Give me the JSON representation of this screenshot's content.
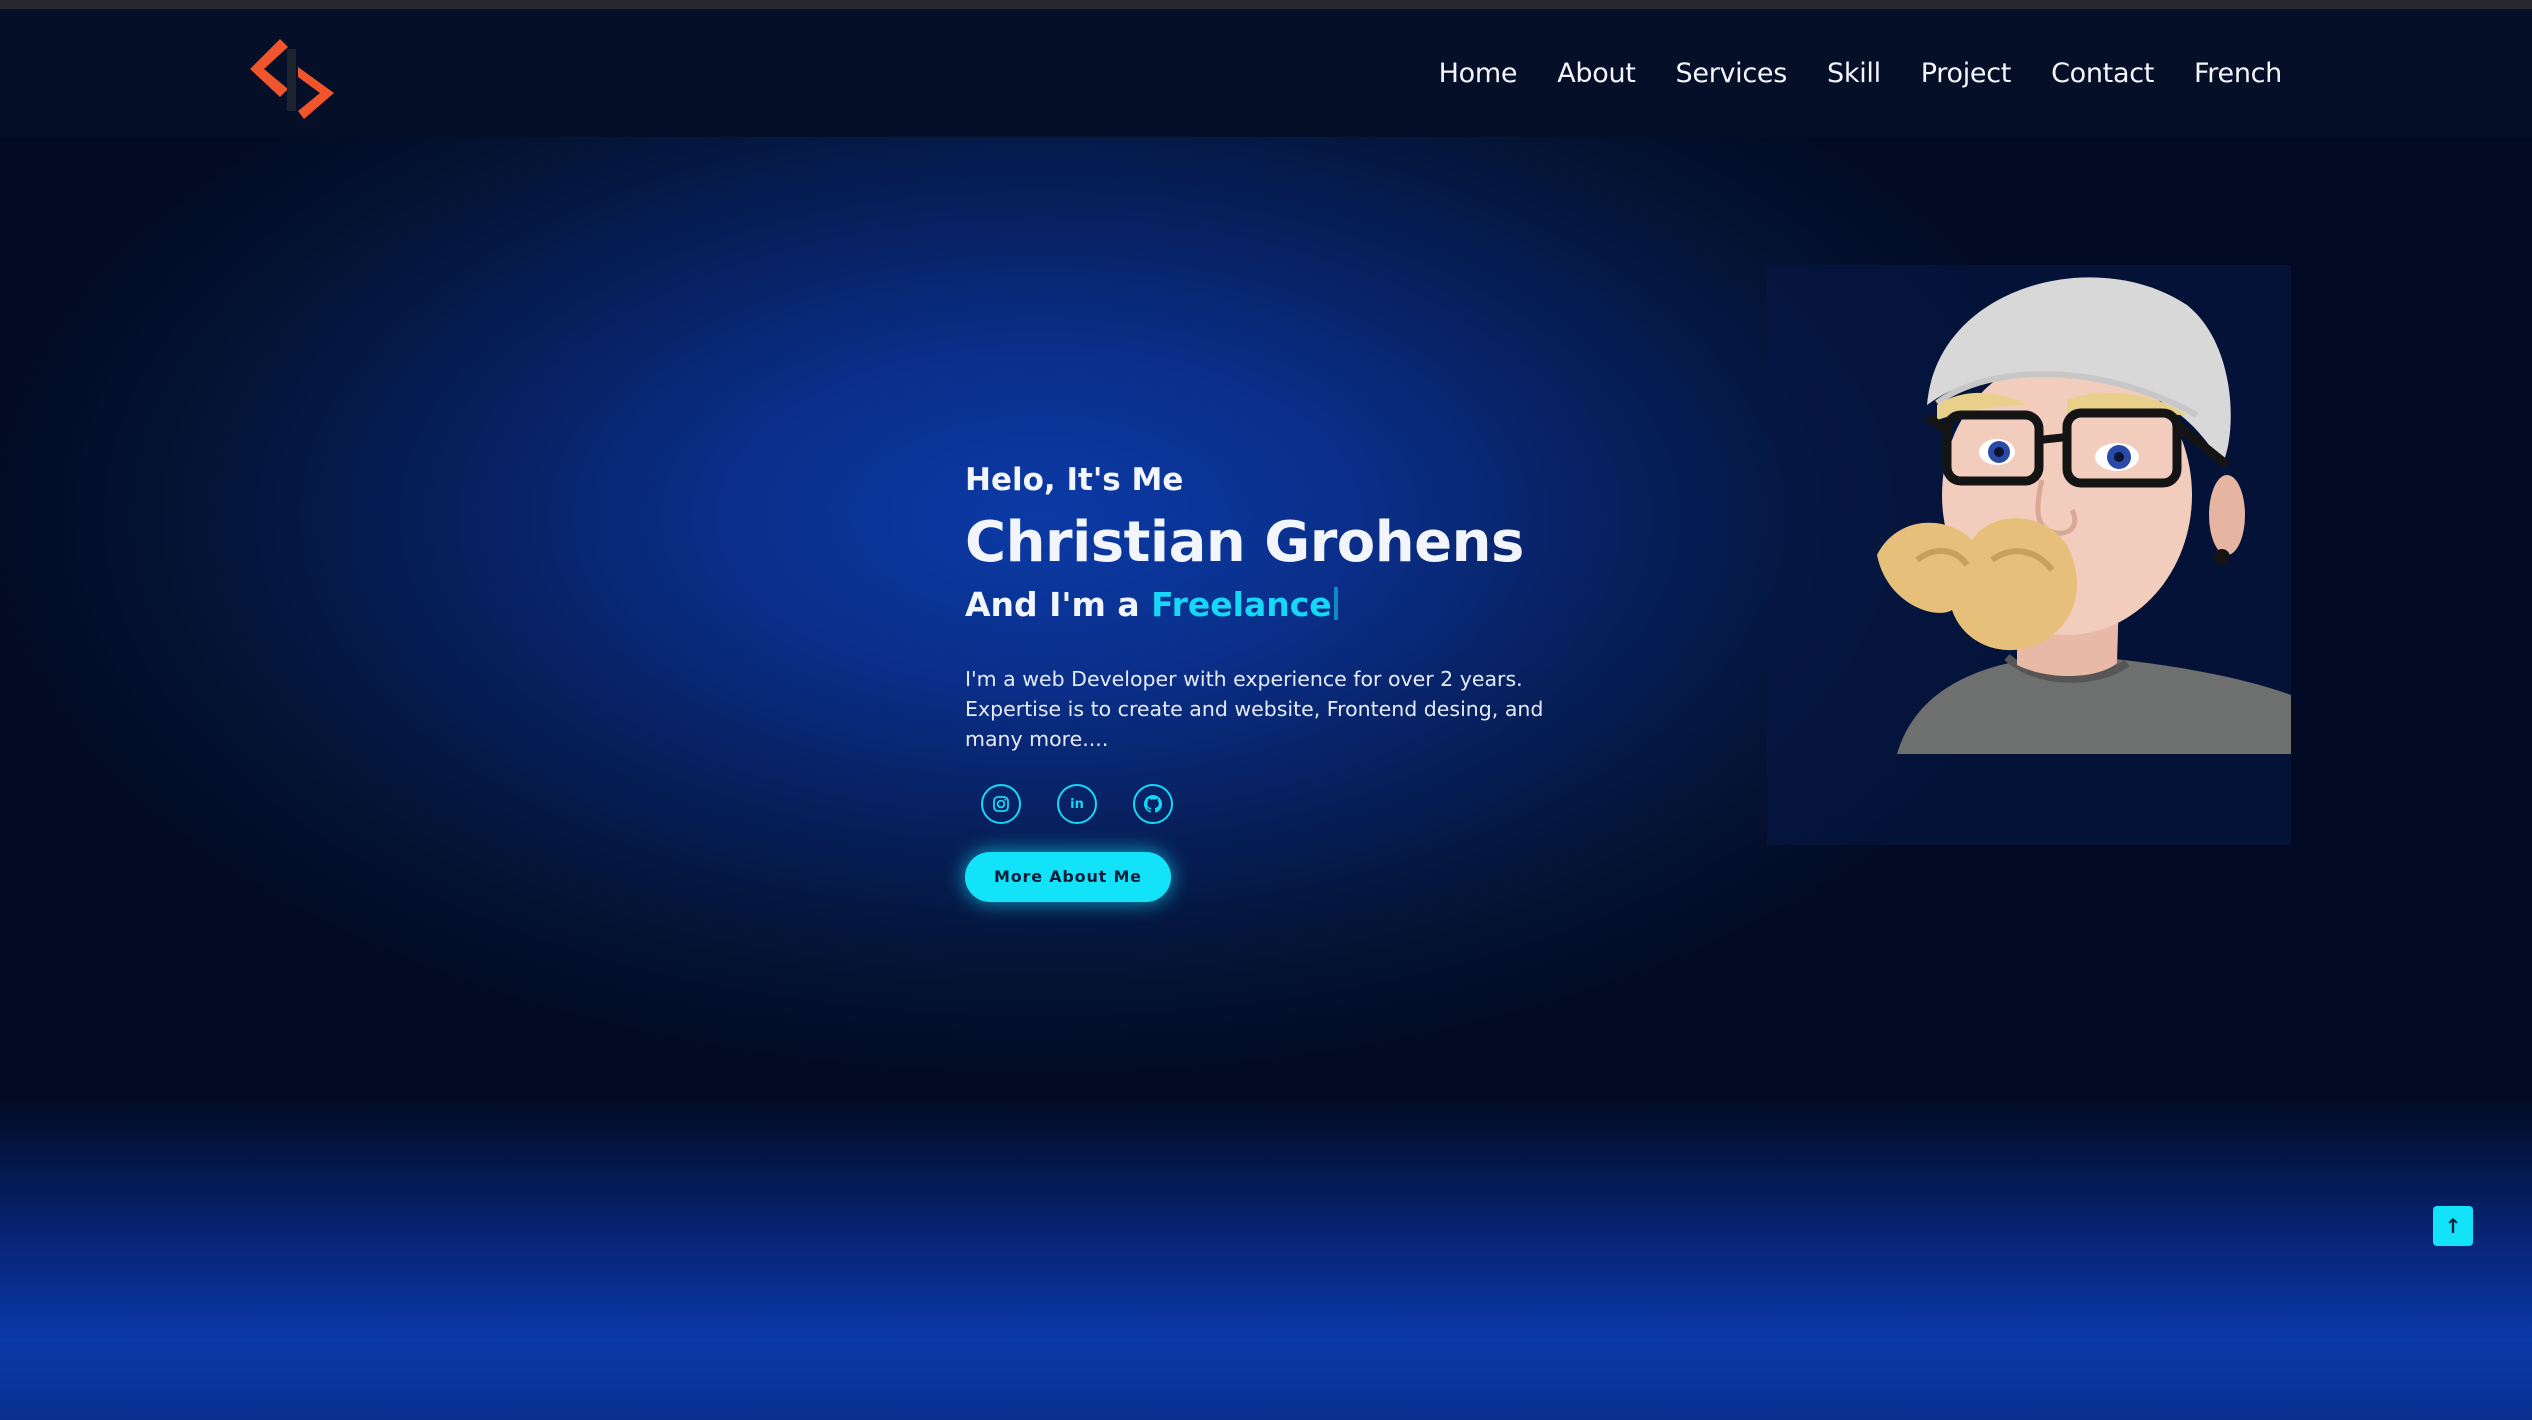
{
  "header": {
    "logo": "code-logo-icon",
    "nav": [
      {
        "label": "Home"
      },
      {
        "label": "About"
      },
      {
        "label": "Services"
      },
      {
        "label": "Skill"
      },
      {
        "label": "Project"
      },
      {
        "label": "Contact"
      },
      {
        "label": "French"
      }
    ]
  },
  "hero": {
    "greeting": "Helo, It's Me",
    "name": "Christian Grohens",
    "role_prefix": "And I'm a",
    "role_value": "Freelance",
    "description": "I'm a web Developer with experience for over 2 years. Expertise is to create and website, Frontend desing, and many more....",
    "socials": [
      {
        "icon": "instagram-icon"
      },
      {
        "icon": "linkedin-icon",
        "text": "in"
      },
      {
        "icon": "github-icon"
      }
    ],
    "cta_label": "More About Me"
  },
  "back_to_top": {
    "icon": "arrow-up-icon",
    "glyph": "↑"
  },
  "colors": {
    "accent": "#13e3f9",
    "logo_orange": "#f2552c",
    "background_dark": "#020b23",
    "hero_blue": "#0b3aa6"
  }
}
